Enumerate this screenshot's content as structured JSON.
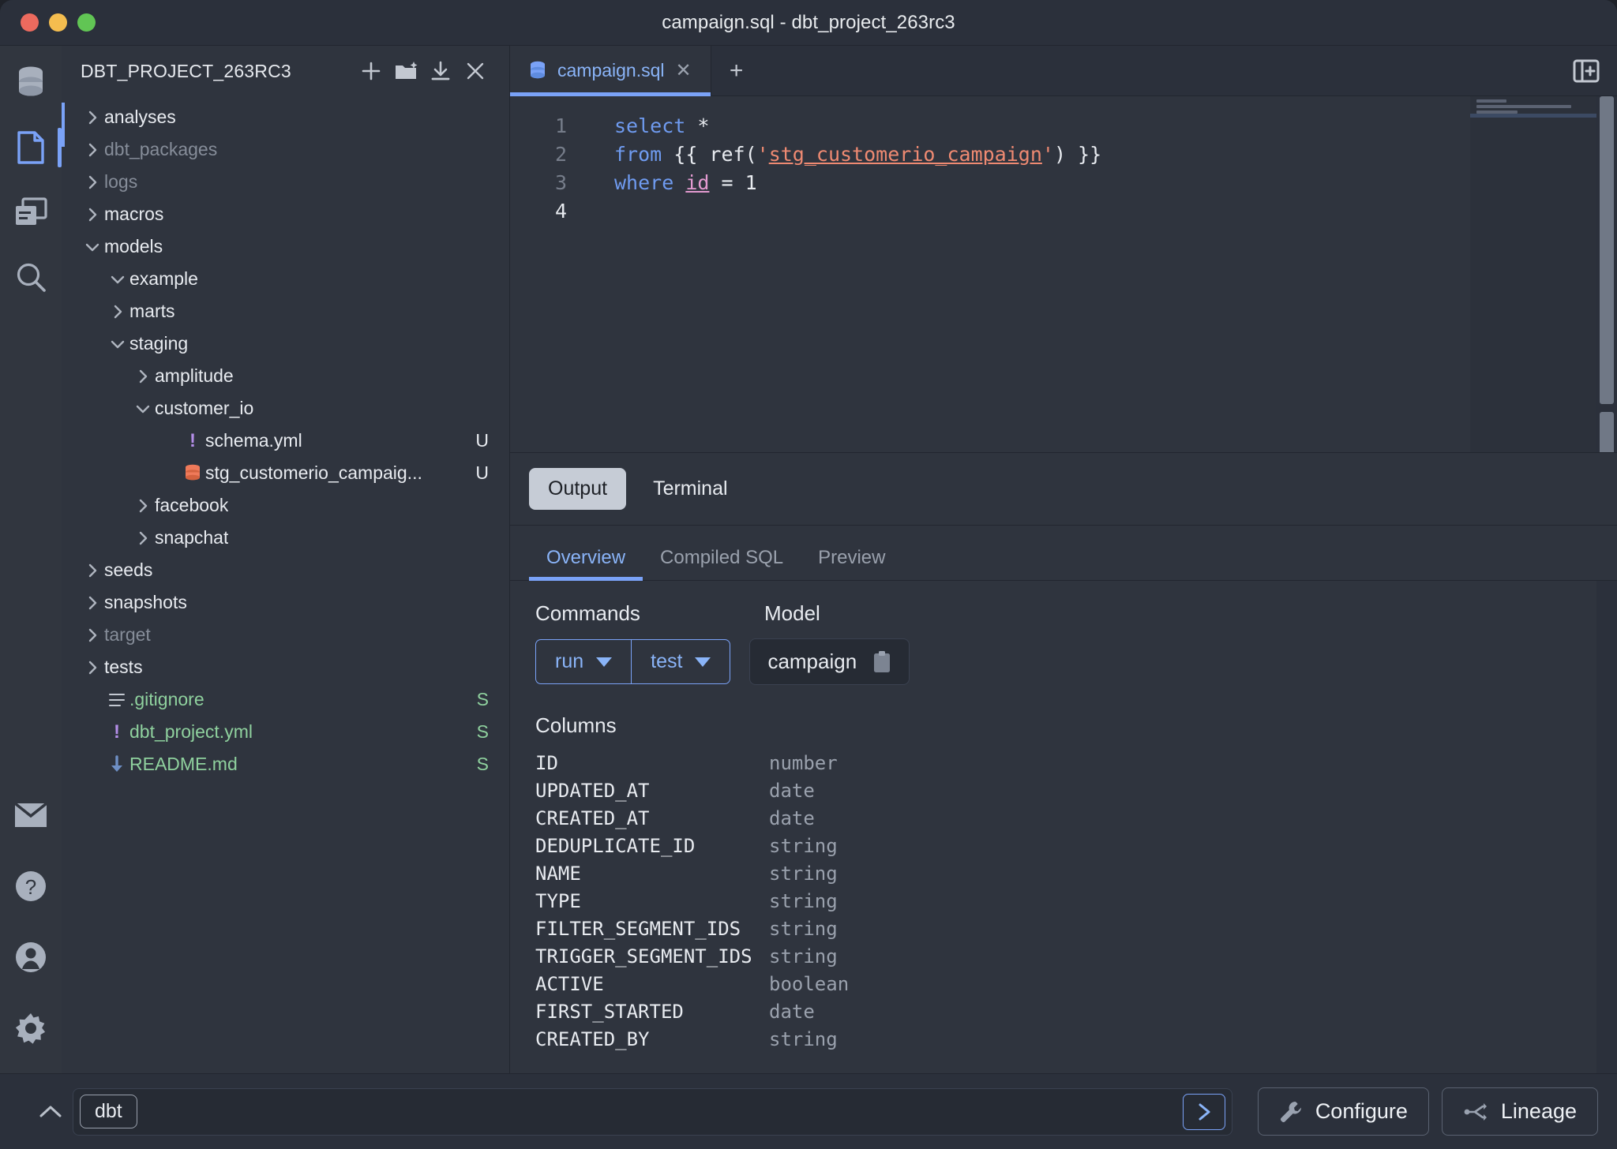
{
  "window": {
    "title": "campaign.sql - dbt_project_263rc3",
    "traffic_lights": [
      "close",
      "minimize",
      "maximize"
    ]
  },
  "activity_bar": {
    "top_items": [
      {
        "icon": "database-icon",
        "active": false
      },
      {
        "icon": "file-icon",
        "active": true
      },
      {
        "icon": "copy-window-icon",
        "active": false
      },
      {
        "icon": "search-icon",
        "active": false
      }
    ],
    "bottom_items": [
      {
        "icon": "mail-icon"
      },
      {
        "icon": "help-icon"
      },
      {
        "icon": "account-icon"
      },
      {
        "icon": "gear-icon"
      }
    ]
  },
  "sidebar": {
    "title": "DBT_PROJECT_263RC3",
    "header_actions": [
      {
        "icon": "plus-icon",
        "name": "new-file"
      },
      {
        "icon": "new-folder-icon",
        "name": "new-folder"
      },
      {
        "icon": "download-icon",
        "name": "download"
      },
      {
        "icon": "close-icon",
        "name": "close-explorer"
      }
    ],
    "tree": [
      {
        "label": "analyses",
        "depth": 0,
        "kind": "folder",
        "state": "collapsed",
        "status": "",
        "dim": false
      },
      {
        "label": "dbt_packages",
        "depth": 0,
        "kind": "folder",
        "state": "collapsed",
        "status": "",
        "dim": true
      },
      {
        "label": "logs",
        "depth": 0,
        "kind": "folder",
        "state": "collapsed",
        "status": "",
        "dim": true
      },
      {
        "label": "macros",
        "depth": 0,
        "kind": "folder",
        "state": "collapsed",
        "status": "",
        "dim": false
      },
      {
        "label": "models",
        "depth": 0,
        "kind": "folder",
        "state": "expanded",
        "status": "",
        "dim": false
      },
      {
        "label": "example",
        "depth": 1,
        "kind": "folder",
        "state": "expanded",
        "status": "",
        "dim": false
      },
      {
        "label": "marts",
        "depth": 1,
        "kind": "folder",
        "state": "collapsed",
        "status": "",
        "dim": false
      },
      {
        "label": "staging",
        "depth": 1,
        "kind": "folder",
        "state": "expanded",
        "status": "",
        "dim": false
      },
      {
        "label": "amplitude",
        "depth": 2,
        "kind": "folder",
        "state": "collapsed",
        "status": "",
        "dim": false
      },
      {
        "label": "customer_io",
        "depth": 2,
        "kind": "folder",
        "state": "expanded",
        "status": "",
        "dim": false
      },
      {
        "label": "schema.yml",
        "depth": 3,
        "kind": "yml",
        "state": "leaf",
        "status": "U",
        "dim": false
      },
      {
        "label": "stg_customerio_campaig...",
        "depth": 3,
        "kind": "model",
        "state": "leaf",
        "status": "U",
        "dim": false
      },
      {
        "label": "facebook",
        "depth": 2,
        "kind": "folder",
        "state": "collapsed",
        "status": "",
        "dim": false
      },
      {
        "label": "snapchat",
        "depth": 2,
        "kind": "folder",
        "state": "collapsed",
        "status": "",
        "dim": false
      },
      {
        "label": "seeds",
        "depth": 0,
        "kind": "folder",
        "state": "collapsed",
        "status": "",
        "dim": false
      },
      {
        "label": "snapshots",
        "depth": 0,
        "kind": "folder",
        "state": "collapsed",
        "status": "",
        "dim": false
      },
      {
        "label": "target",
        "depth": 0,
        "kind": "folder",
        "state": "collapsed",
        "status": "",
        "dim": true
      },
      {
        "label": "tests",
        "depth": 0,
        "kind": "folder",
        "state": "collapsed",
        "status": "",
        "dim": false
      },
      {
        "label": ".gitignore",
        "depth": 0,
        "kind": "text",
        "state": "leaf",
        "status": "S",
        "dim": false,
        "green": true
      },
      {
        "label": "dbt_project.yml",
        "depth": 0,
        "kind": "yml",
        "state": "leaf",
        "status": "S",
        "dim": false,
        "green": true
      },
      {
        "label": "README.md",
        "depth": 0,
        "kind": "md",
        "state": "leaf",
        "status": "S",
        "dim": false,
        "green": true
      }
    ]
  },
  "editor": {
    "tabs": [
      {
        "label": "campaign.sql",
        "icon": "model-icon",
        "active": true,
        "close": "✕"
      }
    ],
    "add_tab_label": "+",
    "panel_toggle_icon": "split-panel-icon",
    "lines": [
      {
        "num": "1",
        "current": false
      },
      {
        "num": "2",
        "current": false
      },
      {
        "num": "3",
        "current": false
      },
      {
        "num": "4",
        "current": true
      }
    ],
    "code": {
      "l1_kw": "select",
      "l1_rest": " *",
      "l2_kw": "from",
      "l2_open": " {{ ref(",
      "l2_quote_open": "'",
      "l2_ref": "stg_customerio_campaign",
      "l2_quote_close": "'",
      "l2_close": ") }}",
      "l3_kw": "where",
      "l3_ident": "id",
      "l3_rest": " = 1"
    }
  },
  "output_panel": {
    "segments": [
      {
        "label": "Output",
        "selected": true
      },
      {
        "label": "Terminal",
        "selected": false
      }
    ],
    "subtabs": [
      {
        "label": "Overview",
        "active": true
      },
      {
        "label": "Compiled SQL",
        "active": false
      },
      {
        "label": "Preview",
        "active": false
      }
    ],
    "commands_title": "Commands",
    "model_title": "Model",
    "commands": [
      {
        "label": "run"
      },
      {
        "label": "test"
      }
    ],
    "model_name": "campaign",
    "model_copy_icon": "clipboard-icon",
    "columns_title": "Columns",
    "columns": [
      {
        "name": "ID",
        "type": "number"
      },
      {
        "name": "UPDATED_AT",
        "type": "date"
      },
      {
        "name": "CREATED_AT",
        "type": "date"
      },
      {
        "name": "DEDUPLICATE_ID",
        "type": "string"
      },
      {
        "name": "NAME",
        "type": "string"
      },
      {
        "name": "TYPE",
        "type": "string"
      },
      {
        "name": "FILTER_SEGMENT_IDS",
        "type": "string"
      },
      {
        "name": "TRIGGER_SEGMENT_IDS",
        "type": "string"
      },
      {
        "name": "ACTIVE",
        "type": "boolean"
      },
      {
        "name": "FIRST_STARTED",
        "type": "date"
      },
      {
        "name": "CREATED_BY",
        "type": "string"
      }
    ]
  },
  "status_bar": {
    "collapse_icon": "chevron-up-icon",
    "chip_label": "dbt",
    "command_placeholder": "",
    "run_icon": "chevron-right-icon",
    "configure_label": "Configure",
    "configure_icon": "wrench-icon",
    "lineage_label": "Lineage",
    "lineage_icon": "lineage-icon"
  },
  "colors": {
    "accent": "#7aa2f7",
    "link": "#8ab4f8",
    "bg": "#2f343e",
    "bg_dark": "#2b303b",
    "green": "#8fd19e",
    "string": "#ef8a72",
    "purple": "#b48ee8"
  }
}
